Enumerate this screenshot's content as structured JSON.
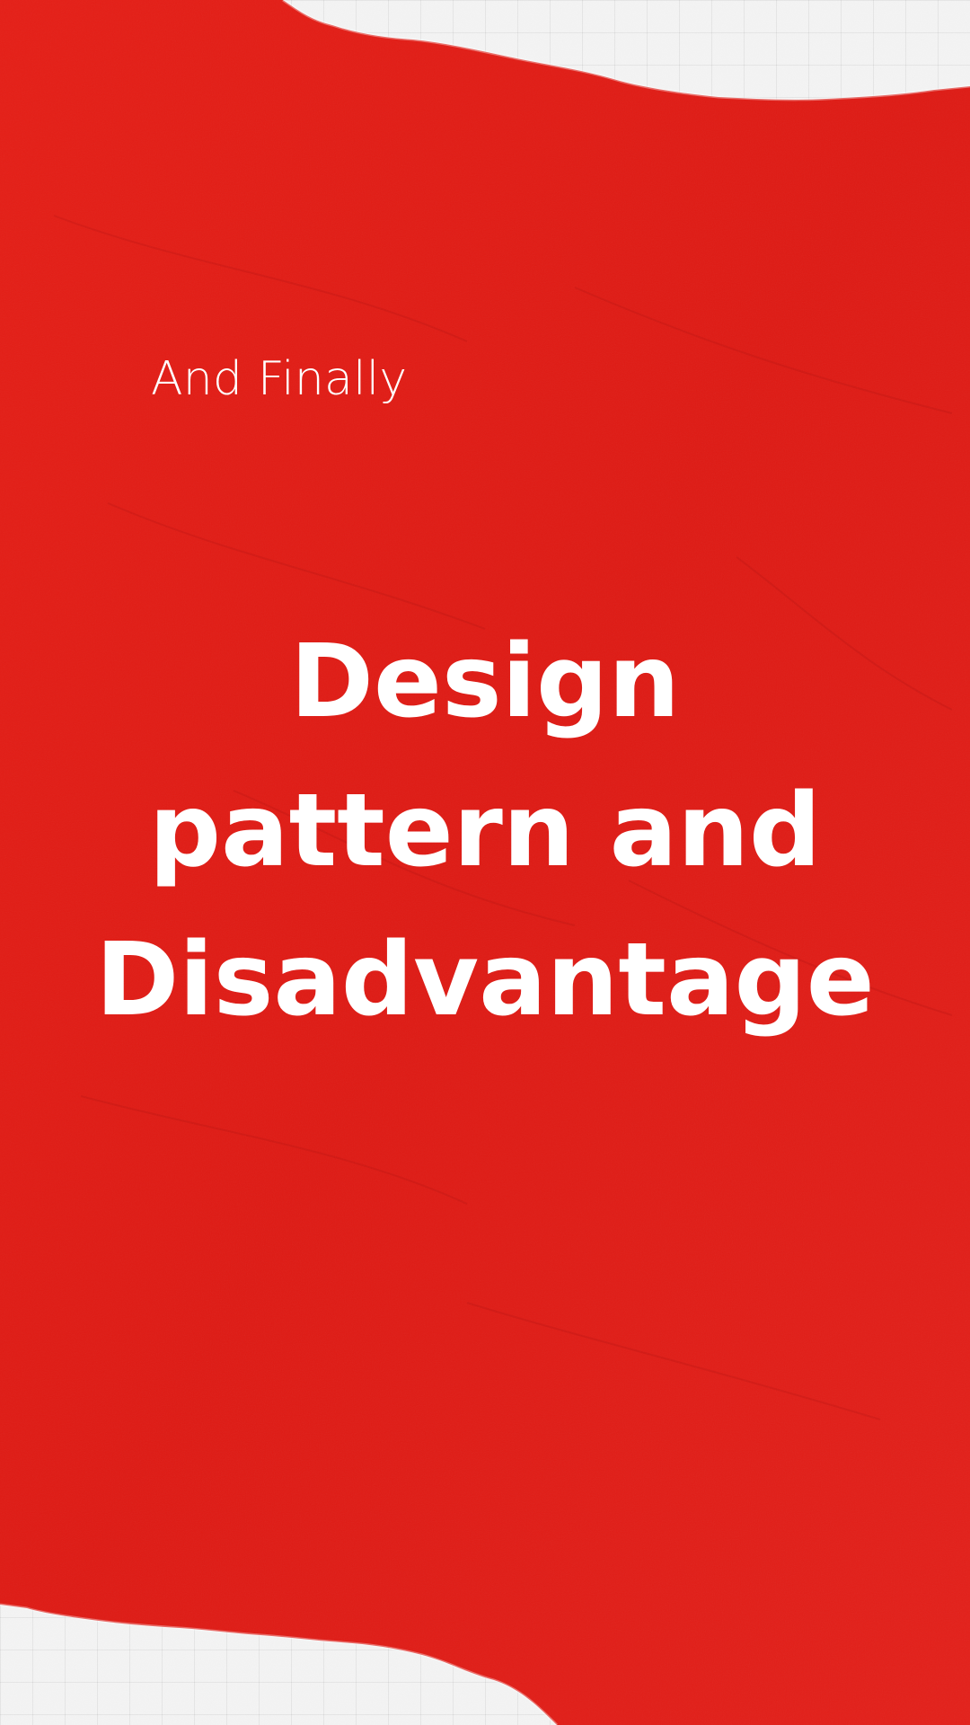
{
  "slide": {
    "subtitle": "And Finally",
    "title_lines": [
      "Design",
      "pattern and",
      "Disadvantage"
    ]
  },
  "colors": {
    "paper_red": "#e01b14",
    "paper_red_dark": "#c81210",
    "text": "#ffffff",
    "background": "#f4f4f4"
  }
}
